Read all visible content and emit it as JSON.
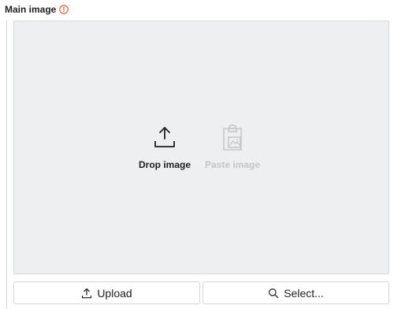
{
  "field": {
    "label": "Main image",
    "info_icon": "info-circle-icon",
    "info_color": "#e0532b"
  },
  "dropzone": {
    "drop_label": "Drop image",
    "drop_icon": "upload-tray-icon",
    "paste_label": "Paste image",
    "paste_icon": "clipboard-image-icon",
    "paste_enabled": false
  },
  "buttons": {
    "upload_label": "Upload",
    "upload_icon": "upload-tray-icon",
    "select_label": "Select...",
    "select_icon": "search-icon"
  }
}
